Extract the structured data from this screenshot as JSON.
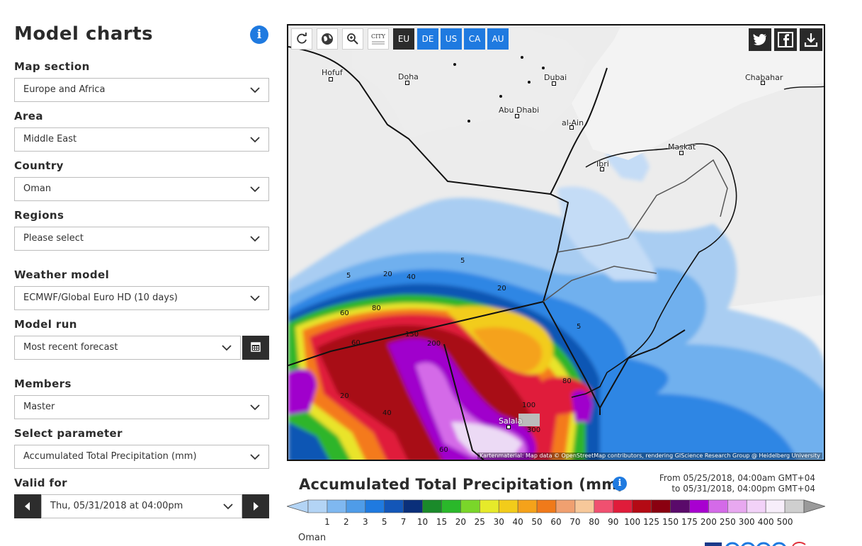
{
  "sidebar": {
    "title": "Model charts",
    "fields": [
      {
        "label": "Map section",
        "value": "Europe and Africa"
      },
      {
        "label": "Area",
        "value": "Middle East"
      },
      {
        "label": "Country",
        "value": "Oman"
      },
      {
        "label": "Regions",
        "value": "Please select"
      },
      {
        "label": "Weather model",
        "value": "ECMWF/Global Euro HD (10 days)"
      },
      {
        "label": "Model run",
        "value": "Most recent forecast"
      },
      {
        "label": "Members",
        "value": "Master"
      },
      {
        "label": "Select parameter",
        "value": "Accumulated Total Precipitation (mm)"
      },
      {
        "label": "Valid for",
        "value": "Thu, 05/31/2018 at 04:00pm"
      }
    ]
  },
  "map": {
    "toolbar": {
      "city_label": "CITY"
    },
    "regions": [
      "EU",
      "DE",
      "US",
      "CA",
      "AU"
    ],
    "cities": [
      "Hofuf",
      "Doha",
      "Dubai",
      "Chabahar",
      "Abu Dhabi",
      "al-Ain",
      "Maskat",
      "Ibri",
      "Salala"
    ],
    "contours": [
      "5",
      "20",
      "40",
      "5",
      "80",
      "60",
      "20",
      "150",
      "200",
      "5",
      "60",
      "80",
      "100",
      "20",
      "40",
      "300",
      "60"
    ],
    "attribution": "Kartenmaterial: Map data © OpenStreetMap contributors, rendering GIScience Research Group @ Heidelberg University"
  },
  "legend": {
    "title": "Accumulated Total Precipitation (mm)",
    "from": "From 05/25/2018, 04:00am GMT+04",
    "to": "to 05/31/2018, 04:00pm GMT+04",
    "ticks": [
      "1",
      "2",
      "3",
      "5",
      "7",
      "10",
      "15",
      "20",
      "25",
      "30",
      "40",
      "50",
      "60",
      "70",
      "80",
      "90",
      "100",
      "125",
      "150",
      "175",
      "200",
      "250",
      "300",
      "400",
      "500"
    ],
    "colors": [
      "#b3d4f5",
      "#7fb8f0",
      "#4f9ce8",
      "#1f7ae0",
      "#1356b8",
      "#0a2f7a",
      "#1a8a2a",
      "#2ab82a",
      "#7ad62a",
      "#e6ea2a",
      "#f2cc1a",
      "#f5a21a",
      "#f07a1a",
      "#f0a070",
      "#f7c89a",
      "#f05070",
      "#e01c3a",
      "#b40a14",
      "#8a0010",
      "#5a0a6a",
      "#a800d0",
      "#d46ae8",
      "#e8a8f0",
      "#f2d2f8",
      "#f7eefa",
      "#cfcfcf"
    ],
    "region": "Oman"
  }
}
